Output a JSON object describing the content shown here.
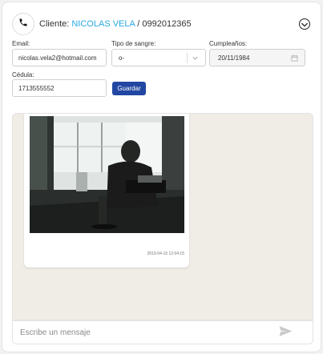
{
  "header": {
    "client_prefix": "Cliente:",
    "client_name": "NICOLAS VELA",
    "client_separator": "/",
    "client_phone": "0992012365"
  },
  "form": {
    "email_label": "Email:",
    "email_value": "nicolas.vela2@hotmail.com",
    "blood_type_label": "Tipo de sangre:",
    "blood_type_value": "o-",
    "birthday_label": "Cumpleaños:",
    "birthday_value": "20/11/1984",
    "id_label": "Cédula:",
    "id_value": "1713555552",
    "save_label": "Guardar"
  },
  "chat": {
    "messages": [
      {
        "type": "image",
        "timestamp": "2019-04-15 12:04:15"
      }
    ],
    "composer_placeholder": "Escribe un mensaje"
  },
  "icons": {
    "phone": "phone-icon",
    "collapse": "chevron-down-circle-icon",
    "select_arrow": "chevron-down-icon",
    "calendar": "calendar-icon",
    "send": "send-icon"
  },
  "colors": {
    "client_name": "#29a8e0",
    "save_button": "#2147a3",
    "chat_background": "#f0ede6"
  }
}
